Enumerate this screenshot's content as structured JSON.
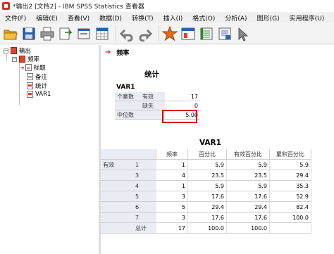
{
  "window": {
    "title": "*输出2 [文档2] - IBM SPSS Statistics 查看器"
  },
  "menu": [
    "文件(F)",
    "编辑(E)",
    "查看(V)",
    "数据(D)",
    "转换(T)",
    "插入(I)",
    "格式(O)",
    "分析(A)",
    "图形(G)",
    "实用程序(U)"
  ],
  "toolbar": [
    "open-icon",
    "save-icon",
    "print-icon",
    "export-icon",
    "dialog-recall-icon",
    "goto-data-icon",
    "undo-icon",
    "redo-icon",
    "goto-output-icon",
    "variables-icon",
    "designate-window-icon",
    "insert-text-icon",
    "select-icon"
  ],
  "outline": {
    "root": "输出",
    "group": "频率",
    "items": [
      "标题",
      "备注",
      "统计",
      "VAR1"
    ],
    "expand_root": "−",
    "expand_group": "−"
  },
  "section": {
    "title": "频率"
  },
  "stats": {
    "title": "统计",
    "variable": "VAR1",
    "rows": [
      {
        "label": "个案数",
        "sub": "有效",
        "value": "17"
      },
      {
        "label": "",
        "sub": "缺失",
        "value": "0"
      },
      {
        "label": "中位数",
        "sub": "",
        "value": "5.00"
      }
    ]
  },
  "freq": {
    "title": "VAR1",
    "headers": [
      "频率",
      "百分比",
      "有效百分比",
      "累积百分比"
    ],
    "group_label": "有效",
    "rows": [
      {
        "label": "1",
        "values": [
          "1",
          "5.9",
          "5.9",
          "5.9"
        ]
      },
      {
        "label": "3",
        "values": [
          "4",
          "23.5",
          "23.5",
          "29.4"
        ]
      },
      {
        "label": "4",
        "values": [
          "1",
          "5.9",
          "5.9",
          "35.3"
        ]
      },
      {
        "label": "5",
        "values": [
          "3",
          "17.6",
          "17.6",
          "52.9"
        ]
      },
      {
        "label": "6",
        "values": [
          "5",
          "29.4",
          "29.4",
          "82.4"
        ]
      },
      {
        "label": "7",
        "values": [
          "3",
          "17.6",
          "17.6",
          "100.0"
        ]
      },
      {
        "label": "总计",
        "values": [
          "17",
          "100.0",
          "100.0",
          ""
        ]
      }
    ]
  }
}
